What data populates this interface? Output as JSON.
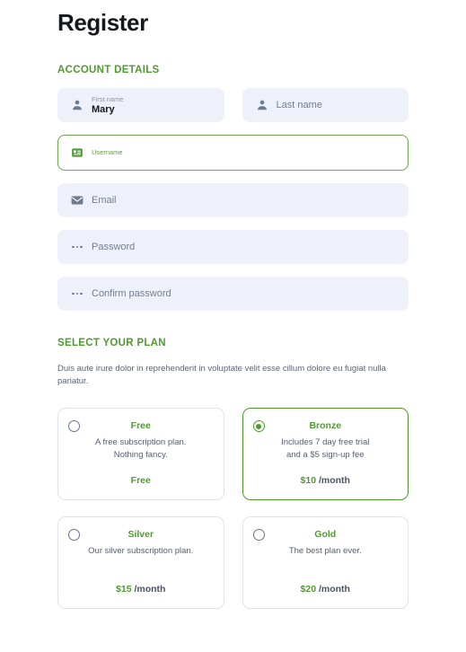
{
  "page": {
    "title": "Register"
  },
  "account_section": {
    "heading": "ACCOUNT DETAILS",
    "fields": [
      {
        "name": "first-name",
        "icon": "person-icon",
        "label": "First name",
        "value": "Mary",
        "placeholder": "First name",
        "focused": false,
        "filled": true
      },
      {
        "name": "last-name",
        "icon": "person-icon",
        "label": "Last name",
        "value": "",
        "placeholder": "Last name",
        "focused": false,
        "filled": false
      },
      {
        "name": "username",
        "icon": "id-badge-icon",
        "label": "Username",
        "value": "",
        "placeholder": "Username",
        "focused": true,
        "filled": false
      },
      {
        "name": "email",
        "icon": "envelope-icon",
        "label": "Email",
        "value": "",
        "placeholder": "Email",
        "focused": false,
        "filled": false
      },
      {
        "name": "password",
        "icon": "dots-icon",
        "label": "Password",
        "value": "",
        "placeholder": "Password",
        "focused": false,
        "filled": false
      },
      {
        "name": "confirm-password",
        "icon": "dots-icon",
        "label": "Confirm password",
        "value": "",
        "placeholder": "Confirm password",
        "focused": false,
        "filled": false
      }
    ]
  },
  "plan_section": {
    "heading": "SELECT YOUR PLAN",
    "description": "Duis aute irure dolor in reprehenderit in voluptate velit esse cillum dolore eu fugiat nulla pariatur.",
    "plans": [
      {
        "name": "Free",
        "description_line1": "A free subscription plan.",
        "description_line2": "Nothing fancy.",
        "price": "Free",
        "period": "",
        "selected": false
      },
      {
        "name": "Bronze",
        "description_line1": "Includes 7 day free trial",
        "description_line2": "and a $5 sign-up fee",
        "price": "$10",
        "period": "/month",
        "selected": true
      },
      {
        "name": "Silver",
        "description_line1": "Our silver subscription plan.",
        "description_line2": "",
        "price": "$15",
        "period": "/month",
        "selected": false
      },
      {
        "name": "Gold",
        "description_line1": "The best plan ever.",
        "description_line2": "",
        "price": "$20",
        "period": "/month",
        "selected": false
      }
    ]
  },
  "colors": {
    "accent_green": "#4f9b2e",
    "field_background": "#eff1fa",
    "card_border": "#dfe3ee",
    "text_dark": "#15181d",
    "text_muted": "#5b6474"
  }
}
